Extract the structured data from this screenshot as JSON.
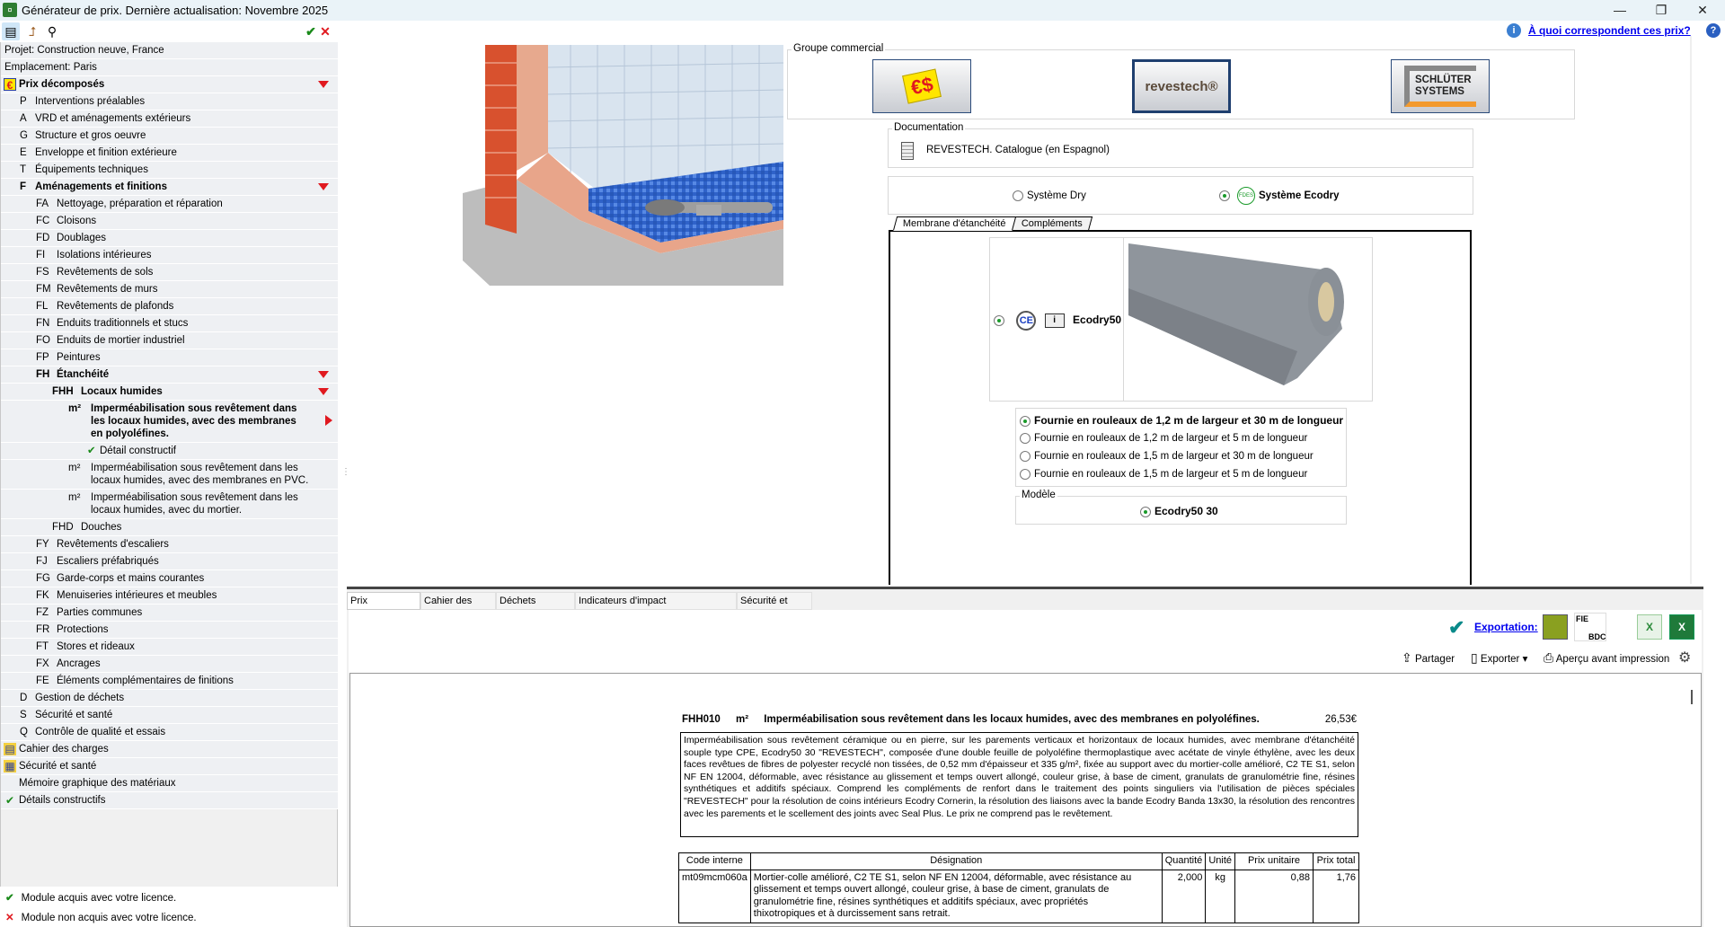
{
  "window": {
    "title": "Générateur de prix. Dernière actualisation: Novembre 2025",
    "minimize": "—",
    "restore": "❐",
    "close": "✕"
  },
  "toolbar": {
    "ok": "✔",
    "cancel": "✕"
  },
  "tree": [
    {
      "lvl": 0,
      "label": "Projet: Construction neuve, France"
    },
    {
      "lvl": 0,
      "label": "Emplacement: Paris"
    },
    {
      "lvl": 0,
      "label": "Prix décomposés",
      "bold": true,
      "icon": "€",
      "mark": "down"
    },
    {
      "lvl": 1,
      "code": "P",
      "label": "Interventions préalables"
    },
    {
      "lvl": 1,
      "code": "A",
      "label": "VRD et aménagements extérieurs"
    },
    {
      "lvl": 1,
      "code": "G",
      "label": "Structure et gros oeuvre"
    },
    {
      "lvl": 1,
      "code": "E",
      "label": "Enveloppe et finition extérieure"
    },
    {
      "lvl": 1,
      "code": "T",
      "label": "Équipements techniques"
    },
    {
      "lvl": 1,
      "code": "F",
      "label": "Aménagements et finitions",
      "bold": true,
      "mark": "down"
    },
    {
      "lvl": 2,
      "code": "FA",
      "label": "Nettoyage, préparation et réparation"
    },
    {
      "lvl": 2,
      "code": "FC",
      "label": "Cloisons"
    },
    {
      "lvl": 2,
      "code": "FD",
      "label": "Doublages"
    },
    {
      "lvl": 2,
      "code": "FI",
      "label": "Isolations intérieures"
    },
    {
      "lvl": 2,
      "code": "FS",
      "label": "Revêtements de sols"
    },
    {
      "lvl": 2,
      "code": "FM",
      "label": "Revêtements de murs"
    },
    {
      "lvl": 2,
      "code": "FL",
      "label": "Revêtements de plafonds"
    },
    {
      "lvl": 2,
      "code": "FN",
      "label": "Enduits traditionnels et stucs"
    },
    {
      "lvl": 2,
      "code": "FO",
      "label": "Enduits de mortier industriel"
    },
    {
      "lvl": 2,
      "code": "FP",
      "label": "Peintures"
    },
    {
      "lvl": 2,
      "code": "FH",
      "label": "Étanchéité",
      "bold": true,
      "mark": "down"
    },
    {
      "lvl": 3,
      "code": "FHH",
      "label": "Locaux humides",
      "bold": true,
      "mark": "down"
    },
    {
      "lvl": 4,
      "code": "m²",
      "label": "Imperméabilisation sous revêtement dans les locaux humides, avec des membranes en polyoléfines.",
      "bold": true,
      "mark": "right"
    },
    {
      "lvl": 5,
      "code": "✔",
      "label": "Détail constructif"
    },
    {
      "lvl": 4,
      "code": "m²",
      "label": "Imperméabilisation sous revêtement dans les locaux humides, avec des membranes en PVC."
    },
    {
      "lvl": 4,
      "code": "m²",
      "label": "Imperméabilisation sous revêtement dans les locaux humides, avec du mortier."
    },
    {
      "lvl": 3,
      "code": "FHD",
      "label": "Douches"
    },
    {
      "lvl": 2,
      "code": "FY",
      "label": "Revêtements d'escaliers"
    },
    {
      "lvl": 2,
      "code": "FJ",
      "label": "Escaliers préfabriqués"
    },
    {
      "lvl": 2,
      "code": "FG",
      "label": "Garde-corps et mains courantes"
    },
    {
      "lvl": 2,
      "code": "FK",
      "label": "Menuiseries intérieures et meubles"
    },
    {
      "lvl": 2,
      "code": "FZ",
      "label": "Parties communes"
    },
    {
      "lvl": 2,
      "code": "FR",
      "label": "Protections"
    },
    {
      "lvl": 2,
      "code": "FT",
      "label": "Stores et rideaux"
    },
    {
      "lvl": 2,
      "code": "FX",
      "label": "Ancrages"
    },
    {
      "lvl": 2,
      "code": "FE",
      "label": "Éléments complémentaires de finitions"
    },
    {
      "lvl": 1,
      "code": "D",
      "label": "Gestion de déchets"
    },
    {
      "lvl": 1,
      "code": "S",
      "label": "Sécurité et santé"
    },
    {
      "lvl": 1,
      "code": "Q",
      "label": "Contrôle de qualité et essais"
    },
    {
      "lvl": 0,
      "label": "Cahier des charges",
      "icon": "▤"
    },
    {
      "lvl": 0,
      "label": "Sécurité et santé",
      "icon": "▦"
    },
    {
      "lvl": 0,
      "label": "Mémoire graphique des matériaux",
      "icon": ""
    },
    {
      "lvl": 0,
      "label": "Détails constructifs",
      "icon": "✔"
    }
  ],
  "legend": {
    "acquired": "Module acquis avec votre licence.",
    "not_acquired": "Module non acquis avec votre licence."
  },
  "help_link": "À quoi correspondent ces prix?",
  "commercial": {
    "label": "Groupe commercial",
    "brands": [
      "€$",
      "revestech®",
      "SCHLÜTER SYSTEMS"
    ]
  },
  "documentation": {
    "label": "Documentation",
    "item": "REVESTECH. Catalogue (en Espagnol)"
  },
  "systems": {
    "dry": "Système Dry",
    "ecodry": "Système Ecodry",
    "fdes": "FDES"
  },
  "tabs": {
    "membrane": "Membrane d'étanchéité",
    "complements": "Compléments"
  },
  "product": {
    "ce": "CE",
    "name": "Ecodry50"
  },
  "options": [
    "Fournie en rouleaux de 1,2 m de largeur et 30 m de longueur",
    "Fournie en rouleaux de 1,2 m de largeur et 5 m de longueur",
    "Fournie en rouleaux de 1,5 m de largeur et 30 m de longueur",
    "Fournie en rouleaux de 1,5 m de largeur et 5 m de longueur"
  ],
  "model": {
    "label": "Modèle",
    "value": "Ecodry50 30"
  },
  "lower_tabs": [
    "Prix décomposé",
    "Cahier des charges",
    "Déchets générés",
    "Indicateurs d'impact environnemental",
    "Sécurité et santé"
  ],
  "export": {
    "label": "Exportation:",
    "fie": "FIE",
    "bdc": "BDC",
    "share": "Partager",
    "export": "Exporter",
    "preview": "Aperçu avant impression"
  },
  "report": {
    "code": "FHH010",
    "unit": "m²",
    "title": "Imperméabilisation sous revêtement dans les locaux humides, avec des membranes en polyoléfines.",
    "price": "26,53€",
    "description": "Imperméabilisation sous revêtement céramique ou en pierre, sur les parements verticaux et horizontaux de locaux humides, avec membrane d'étanchéité souple type CPE, Ecodry50 30 \"REVESTECH\", composée d'une double feuille de polyoléfine thermoplastique avec acétate de vinyle éthylène, avec les deux faces revêtues de fibres de polyester recyclé non tissées, de 0,52 mm d'épaisseur et 335 g/m², fixée au support avec du mortier-colle amélioré, C2 TE S1, selon NF EN 12004, déformable, avec résistance au glissement et temps ouvert allongé, couleur grise, à base de ciment, granulats de granulométrie fine, résines synthétiques et additifs spéciaux. Comprend les compléments de renfort dans le traitement des points singuliers via l'utilisation de pièces spéciales \"REVESTECH\" pour la résolution de coins intérieurs Ecodry Cornerin, la résolution des liaisons avec la bande Ecodry Banda 13x30, la résolution des rencontres avec les parements et le scellement des joints avec Seal Plus. Le prix ne comprend pas le revêtement.",
    "columns": [
      "Code interne",
      "Désignation",
      "Quantité",
      "Unité",
      "Prix unitaire",
      "Prix total"
    ],
    "rows": [
      [
        "mt09mcm060a",
        "Mortier-colle amélioré, C2 TE S1, selon NF EN 12004, déformable, avec résistance au glissement et temps ouvert allongé, couleur grise, à base de ciment, granulats de granulométrie fine, résines synthétiques et additifs spéciaux, avec propriétés thixotropiques et à durcissement sans retrait.",
        "2,000",
        "kg",
        "0,88",
        "1,76"
      ]
    ]
  }
}
